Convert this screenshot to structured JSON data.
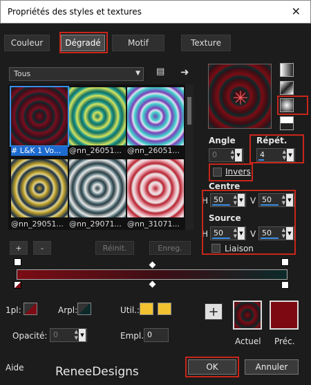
{
  "window": {
    "title": "Propriétés des styles et textures",
    "close": "✕"
  },
  "tabs": [
    {
      "label": "Couleur"
    },
    {
      "label": "Dégradé"
    },
    {
      "label": "Motif"
    },
    {
      "label": "Texture"
    }
  ],
  "category": {
    "value": "Tous"
  },
  "gradients": [
    {
      "caption": "# L&K 1 Vo...",
      "selected": true,
      "colors": [
        "#7a0e1e",
        "#3b0f1b",
        "#0e2a2e"
      ]
    },
    {
      "caption": "@nn_26051...",
      "selected": false,
      "colors": [
        "#0e6f63",
        "#d8e45a",
        "#2a9c8c"
      ]
    },
    {
      "caption": "@nn_26051...",
      "selected": false,
      "colors": [
        "#7a3fb8",
        "#3fd2cc",
        "#e0e0f0"
      ]
    },
    {
      "caption": "@nn_29051...",
      "selected": false,
      "colors": [
        "#b89b2a",
        "#1a2f4a",
        "#e0d38a"
      ]
    },
    {
      "caption": "@nn_29071...",
      "selected": false,
      "colors": [
        "#2a3e44",
        "#e8e8e8",
        "#6c8890"
      ]
    },
    {
      "caption": "@nn_31071...",
      "selected": false,
      "colors": [
        "#b8202e",
        "#f0c0c8",
        "#e8e8e8"
      ]
    }
  ],
  "list_buttons": {
    "add": "+",
    "remove": "-",
    "reset": "Réinit.",
    "save": "Enreg."
  },
  "params": {
    "angle_label": "Angle",
    "angle_value": "0",
    "repeat_label": "Répét.",
    "repeat_value": "4",
    "invert_label": "Invers",
    "center_label": "Centre",
    "center_h_label": "H",
    "center_h": "50",
    "center_v_label": "V",
    "center_v": "50",
    "source_label": "Source",
    "source_h_label": "H",
    "source_h": "50",
    "source_v_label": "V",
    "source_v": "50",
    "link_label": "Liaison"
  },
  "stops": {
    "first_label": "1pl:",
    "last_label": "Arpl:",
    "util_label": "Util.:",
    "opacity_label": "Opacité:",
    "opacity_value": "0",
    "location_label": "Empl.:",
    "location_value": "0",
    "first_color": "#7b0c14",
    "last_color": "#0c2a2a",
    "util_color": "#f2c230"
  },
  "swatches": {
    "add": "+",
    "current_label": "Actuel",
    "previous_label": "Préc.",
    "previous_color": "#7d0a12"
  },
  "footer": {
    "help": "Aide",
    "ok": "OK",
    "cancel": "Annuler",
    "brand": "ReneeDesigns"
  }
}
